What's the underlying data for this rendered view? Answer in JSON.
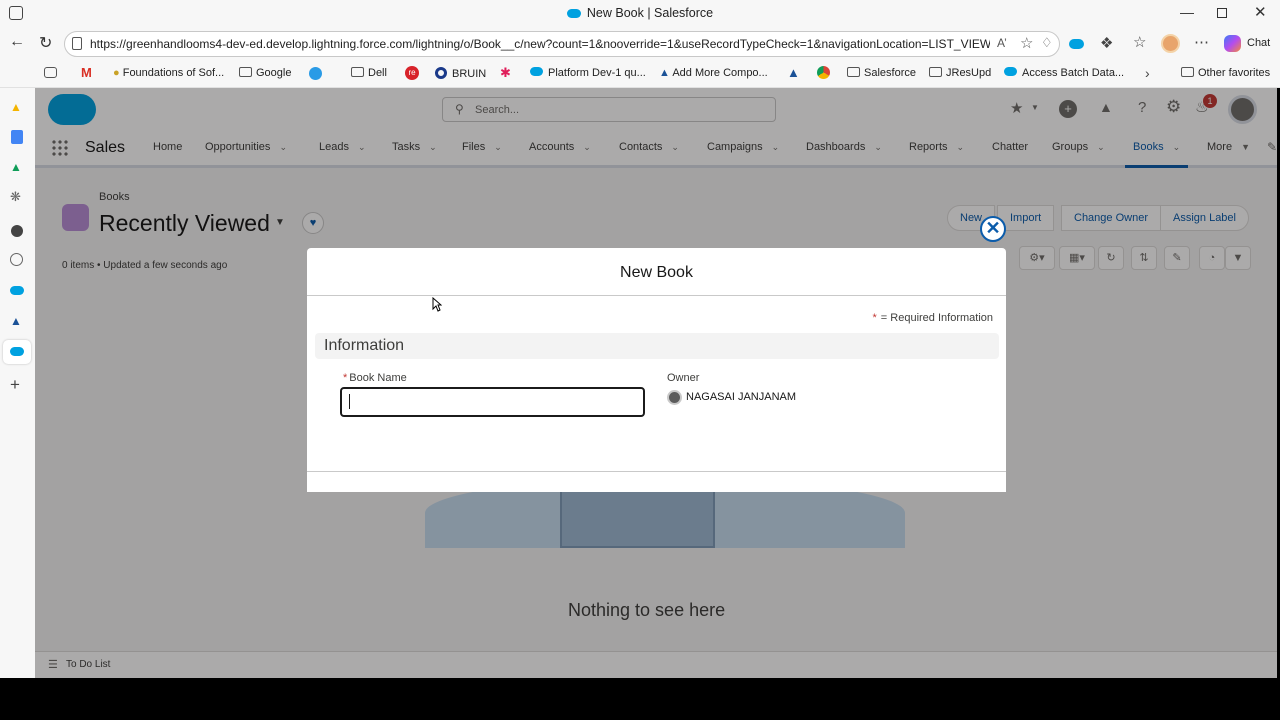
{
  "window": {
    "title": "New Book | Salesforce",
    "url": "https://greenhandlooms4-dev-ed.develop.lightning.force.com/lightning/o/Book__c/new?count=1&nooverride=1&useRecordTypeCheck=1&navigationLocation=LIST_VIEW...",
    "chat_label": "Chat"
  },
  "bookmarks": [
    "Foundations of Sof...",
    "Google",
    "Dell",
    "BRUIN",
    "Platform Dev-1 qu...",
    "Add More Compo...",
    "Salesforce",
    "JResUpd",
    "Access Batch Data...",
    "Other favorites"
  ],
  "header": {
    "search_placeholder": "Search...",
    "notification_count": "1"
  },
  "nav": {
    "app_name": "Sales",
    "items": [
      "Home",
      "Opportunities",
      "Leads",
      "Tasks",
      "Files",
      "Accounts",
      "Contacts",
      "Campaigns",
      "Dashboards",
      "Reports",
      "Chatter",
      "Groups",
      "Books",
      "More"
    ]
  },
  "list": {
    "object": "Books",
    "view_name": "Recently Viewed",
    "status": "0 items • Updated a few seconds ago",
    "buttons": [
      "New",
      "Import",
      "Change Owner",
      "Assign Label"
    ],
    "empty_message": "Nothing to see here",
    "footer": "To Do List"
  },
  "modal": {
    "title": "New Book",
    "required_info": "= Required Information",
    "required_star": "*",
    "section": "Information",
    "book_name_label": "Book Name",
    "book_name_value": "",
    "owner_label": "Owner",
    "owner_value": "NAGASAI JANJANAM"
  },
  "colors": {
    "brand": "#0b5cab",
    "cloud": "#00a1e0",
    "required": "#c23934"
  }
}
